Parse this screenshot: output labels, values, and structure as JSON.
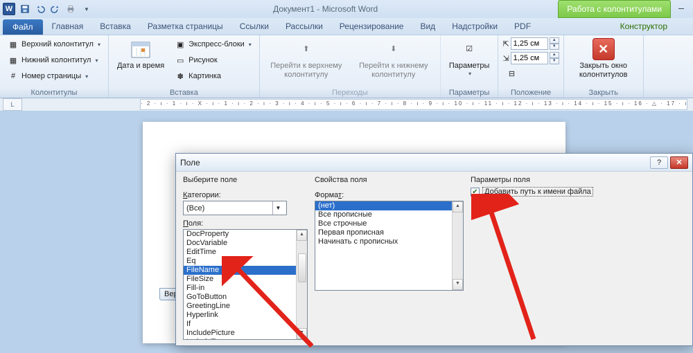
{
  "title": "Документ1 - Microsoft Word",
  "contextual_tab_header": "Работа с колонтитулами",
  "ribbon_tabs": {
    "file": "Файл",
    "home": "Главная",
    "insert": "Вставка",
    "page_layout": "Разметка страницы",
    "references": "Ссылки",
    "mailings": "Рассылки",
    "review": "Рецензирование",
    "view": "Вид",
    "addins": "Надстройки",
    "pdf": "PDF",
    "design": "Конструктор"
  },
  "ribbon": {
    "group_headerfooter": "Колонтитулы",
    "top_header": "Верхний колонтитул",
    "bottom_header": "Нижний колонтитул",
    "page_number": "Номер страницы",
    "group_insert": "Вставка",
    "date_time": "Дата и время",
    "quick_parts": "Экспресс-блоки",
    "picture": "Рисунок",
    "clipart": "Картинка",
    "group_nav": "Переходы",
    "goto_header": "Перейти к верхнему колонтитулу",
    "goto_footer": "Перейти к нижнему колонтитулу",
    "group_options": "Параметры",
    "options_btn": "Параметры",
    "group_position": "Положение",
    "pos_top": "1,25 см",
    "pos_bottom": "1,25 см",
    "group_close": "Закрыть",
    "close_hf": "Закрыть окно колонтитулов"
  },
  "ruler_corner": "L",
  "ruler_text": "· 2 · ı · 1 · ı · X · ı · 1 · ı · 2 · ı · 3 · ı · 4 · ı · 5 · ı · 6 · ı · 7 · ı · 8 · ı · 9 · ı · 10 · ı · 11 · ı · 12 · ı · 13 · ı · 14 · ı · 15 · ı · 16 · △ · 17 · ı ·",
  "hf_tag": "Вер",
  "dialog": {
    "title": "Поле",
    "choose_field": "Выберите поле",
    "categories_label": "Категории:",
    "categories_value": "(Все)",
    "fields_label": "Поля:",
    "fields": [
      "DocProperty",
      "DocVariable",
      "EditTime",
      "Eq",
      "FileName",
      "FileSize",
      "Fill-in",
      "GoToButton",
      "GreetingLine",
      "Hyperlink",
      "If",
      "IncludePicture",
      "IncludeText"
    ],
    "fields_selected": "FileName",
    "properties_title": "Свойства поля",
    "format_label": "Формат:",
    "formats": [
      "(нет)",
      "Все прописные",
      "Все строчные",
      "Первая прописная",
      "Начинать с прописных"
    ],
    "formats_selected": "(нет)",
    "params_title": "Параметры поля",
    "add_path_label": "Добавить путь к имени файла"
  }
}
